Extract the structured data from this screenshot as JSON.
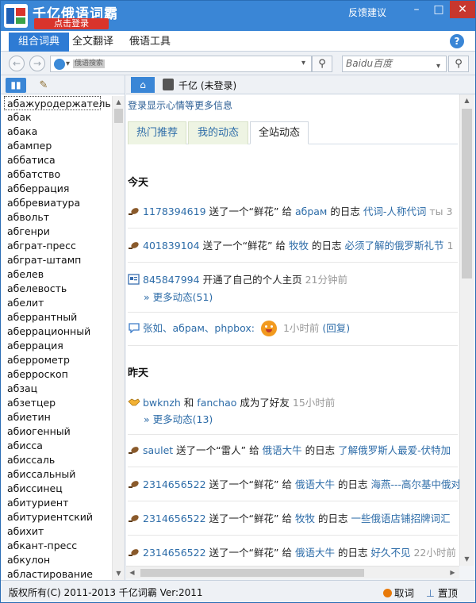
{
  "window": {
    "title": "千亿俄语词霸",
    "login_button": "点击登录",
    "feedback_link": "反馈建议",
    "minimize": "–",
    "maximize": "□",
    "close": "✕"
  },
  "main_tabs": [
    {
      "label": "组合词典"
    },
    {
      "label": "全文翻译"
    },
    {
      "label": "俄语工具"
    }
  ],
  "help": "?",
  "nav": {
    "back": "←",
    "forward": "→",
    "address_label": "俄语搜索",
    "search_engine": "Baidu百度"
  },
  "word_list": [
    "абажуродержатель",
    "абак",
    "абака",
    "абампер",
    "аббатиса",
    "аббатство",
    "абберрация",
    "аббревиатура",
    "абвольт",
    "абгенри",
    "абграт-пресс",
    "абграт-штамп",
    "абелев",
    "абелевость",
    "абелит",
    "аберрантный",
    "аберрационный",
    "аберрация",
    "аберрометр",
    "аберроскоп",
    "абзац",
    "абзетцер",
    "абиетин",
    "абиогенный",
    "абисса",
    "абиссаль",
    "абиссальный",
    "абиссинец",
    "абитуриент",
    "абитуриентский",
    "абихит",
    "абкант-пресс",
    "абкулон",
    "абластирование"
  ],
  "right_header": {
    "home": "⌂",
    "user_label": "千亿 (未登录)"
  },
  "content": {
    "login_hint": "登录显示心情等更多信息",
    "tabs": [
      {
        "label": "热门推荐"
      },
      {
        "label": "我的动态"
      },
      {
        "label": "全站动态"
      }
    ],
    "today_label": "今天",
    "yesterday_label": "昨天",
    "feed": [
      {
        "user": "1178394619",
        "verb": "送了一个",
        "gift": "“鲜花”",
        "to_word": "给",
        "target": "абрам",
        "of_word": "的日志",
        "title": "代词-人称代词",
        "extra": "ты 3"
      },
      {
        "user": "401839104",
        "verb": "送了一个",
        "gift": "“鲜花”",
        "to_word": "给",
        "target": "牧牧",
        "of_word": "的日志",
        "title": "必须了解的俄罗斯礼节",
        "extra": "1"
      },
      {
        "user": "845847994",
        "action": "开通了自己的个人主页",
        "time": "21分钟前",
        "more": "» 更多动态(51)"
      },
      {
        "users": "张如、абрам、phpbox:",
        "time": "1小时前",
        "reply": "(回复)"
      },
      {
        "user": "bwknzh",
        "and_word": "和",
        "user2": "fanchao",
        "action": "成为了好友",
        "time": "15小时前",
        "more": "» 更多动态(13)"
      },
      {
        "user": "saulet",
        "verb": "送了一个",
        "gift": "“雷人”",
        "to_word": "给",
        "target": "俄语大牛",
        "of_word": "的日志",
        "title": "了解俄罗斯人最爱-伏特加"
      },
      {
        "user": "2314656522",
        "verb": "送了一个",
        "gift": "“鲜花”",
        "to_word": "给",
        "target": "俄语大牛",
        "of_word": "的日志",
        "title": "海燕---高尔基中俄对"
      },
      {
        "user": "2314656522",
        "verb": "送了一个",
        "gift": "“鲜花”",
        "to_word": "给",
        "target": "牧牧",
        "of_word": "的日志",
        "title": "一些俄语店铺招牌词汇"
      },
      {
        "user": "2314656522",
        "verb": "送了一个",
        "gift": "“鲜花”",
        "to_word": "给",
        "target": "俄语大牛",
        "of_word": "的日志",
        "title": "好久不见",
        "time": "22小时前"
      }
    ]
  },
  "status": {
    "copyright": "版权所有(C) 2011-2013 千亿词霸 Ver:2011",
    "quit": "取词",
    "pin": "置顶"
  },
  "colors": {
    "title_bar": "#3a86d6",
    "active_tab": "#2e7bd4",
    "link": "#2d6ca8",
    "login_red": "#d9342b"
  }
}
